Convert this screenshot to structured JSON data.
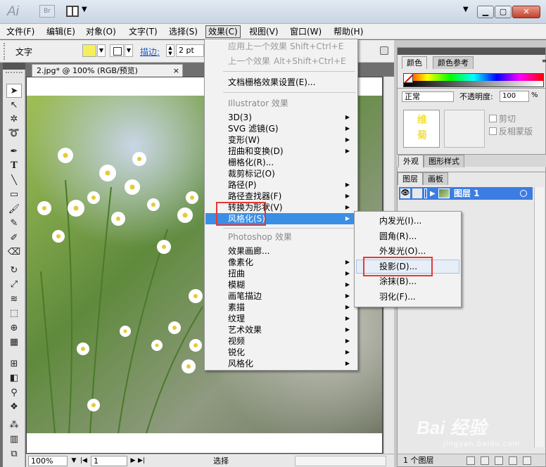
{
  "titlebar": {
    "logo": "Ai",
    "bridge": "Br"
  },
  "menubar": [
    {
      "label": "文件(F)"
    },
    {
      "label": "编辑(E)"
    },
    {
      "label": "对象(O)"
    },
    {
      "label": "文字(T)"
    },
    {
      "label": "选择(S)"
    },
    {
      "label": "效果(C)"
    },
    {
      "label": "视图(V)"
    },
    {
      "label": "窗口(W)"
    },
    {
      "label": "帮助(H)"
    }
  ],
  "controlbar": {
    "tool_label": "文字",
    "stroke_label": "描边:",
    "stroke_width": "2 pt",
    "fill_color": "#f5ef5c"
  },
  "document": {
    "tab_title": "2.jpg* @ 100% (RGB/预览)",
    "tab_close": "×"
  },
  "statusbar": {
    "zoom": "100%",
    "page": "1",
    "status": "选择"
  },
  "effect_menu": {
    "apply_last": "应用上一个效果",
    "apply_last_shortcut": "Shift+Ctrl+E",
    "last_effect": "上一个效果",
    "last_effect_shortcut": "Alt+Shift+Ctrl+E",
    "raster_settings": "文档栅格效果设置(E)...",
    "illustrator_section": "Illustrator 效果",
    "illustrator_items": [
      "3D(3)",
      "SVG 滤镜(G)",
      "变形(W)",
      "扭曲和变换(D)",
      "栅格化(R)...",
      "裁剪标记(O)",
      "路径(P)",
      "路径查找器(F)",
      "转换为形状(V)",
      "风格化(S)"
    ],
    "photoshop_section": "Photoshop 效果",
    "photoshop_items": [
      "效果画廊...",
      "像素化",
      "扭曲",
      "模糊",
      "画笔描边",
      "素描",
      "纹理",
      "艺术效果",
      "视频",
      "锐化",
      "风格化"
    ]
  },
  "stylize_submenu": [
    "内发光(I)...",
    "圆角(R)...",
    "外发光(O)...",
    "投影(D)...",
    "涂抹(B)...",
    "羽化(F)..."
  ],
  "color_panel": {
    "tabs": [
      "颜色",
      "颜色参考"
    ]
  },
  "transparency_panel": {
    "blend_mode": "正常",
    "opacity_label": "不透明度:",
    "opacity_value": "100",
    "opacity_unit": "%",
    "thumb_text": "维菊",
    "clip_label": "剪切",
    "invert_mask_label": "反相蒙版"
  },
  "appearance_tabs": [
    "外观",
    "图形样式"
  ],
  "layers_panel": {
    "tabs": [
      "图层",
      "画板"
    ],
    "layer_name": "图层 1",
    "layer_count": "1 个图层"
  },
  "watermark": {
    "main": "Bai 经验",
    "sub": "jingyan.baidu.com"
  }
}
